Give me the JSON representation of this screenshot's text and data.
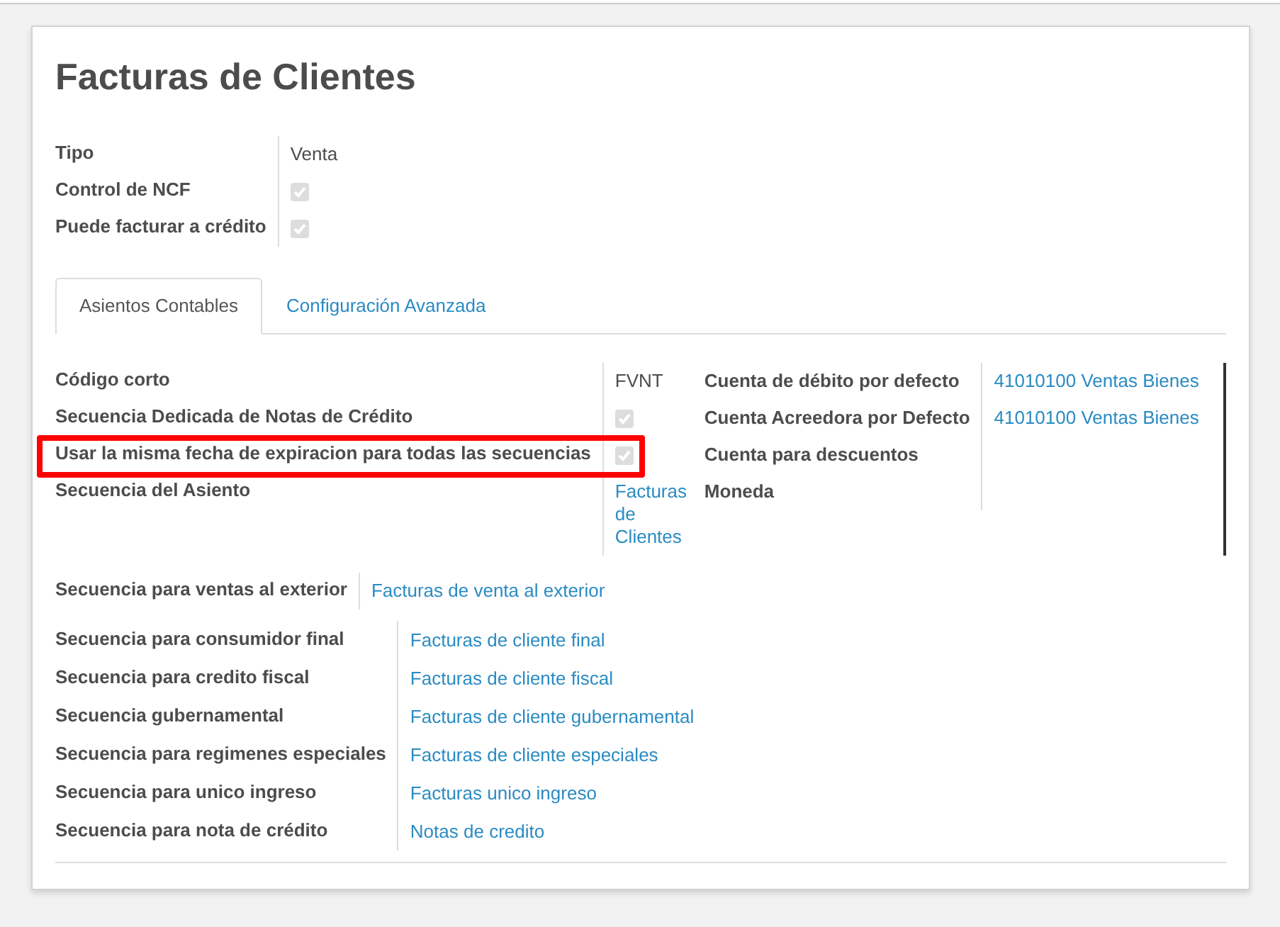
{
  "title": "Facturas de Clientes",
  "header_fields": [
    {
      "label": "Tipo",
      "kind": "text",
      "value": "Venta"
    },
    {
      "label": "Control de NCF",
      "kind": "checkbox",
      "checked": true
    },
    {
      "label": "Puede facturar a crédito",
      "kind": "checkbox",
      "checked": true
    }
  ],
  "tabs": [
    {
      "label": "Asientos Contables",
      "selected": true
    },
    {
      "label": "Configuración Avanzada",
      "selected": false
    }
  ],
  "tab_content": {
    "left_fields": [
      {
        "label": "Código corto",
        "kind": "text",
        "value": "FVNT",
        "highlighted": false
      },
      {
        "label": "Secuencia Dedicada de Notas de Crédito",
        "kind": "checkbox",
        "checked": true,
        "highlighted": false
      },
      {
        "label": "Usar la misma fecha de expiracion para todas las secuencias",
        "kind": "checkbox",
        "checked": true,
        "highlighted": true
      },
      {
        "label": "Secuencia del Asiento",
        "kind": "link",
        "value": "Facturas de Clientes",
        "highlighted": false
      }
    ],
    "right_fields": [
      {
        "label": "Cuenta de débito por defecto",
        "kind": "link",
        "value": "41010100 Ventas Bienes"
      },
      {
        "label": "Cuenta Acreedora por Defecto",
        "kind": "link",
        "value": "41010100 Ventas Bienes"
      },
      {
        "label": "Cuenta para descuentos",
        "kind": "empty"
      },
      {
        "label": "Moneda",
        "kind": "empty"
      }
    ]
  },
  "exterior_fields": [
    {
      "label": "Secuencia para ventas al exterior",
      "kind": "link",
      "value": "Facturas de venta al exterior"
    }
  ],
  "sequence_fields": [
    {
      "label": "Secuencia para consumidor final",
      "kind": "link",
      "value": "Facturas de cliente final"
    },
    {
      "label": "Secuencia para credito fiscal",
      "kind": "link",
      "value": "Facturas de cliente fiscal"
    },
    {
      "label": "Secuencia gubernamental",
      "kind": "link",
      "value": "Facturas de cliente gubernamental"
    },
    {
      "label": "Secuencia para regimenes especiales",
      "kind": "link",
      "value": "Facturas de cliente especiales"
    },
    {
      "label": "Secuencia para unico ingreso",
      "kind": "link",
      "value": "Facturas unico ingreso"
    },
    {
      "label": "Secuencia para nota de crédito",
      "kind": "link",
      "value": "Notas de credito"
    }
  ]
}
